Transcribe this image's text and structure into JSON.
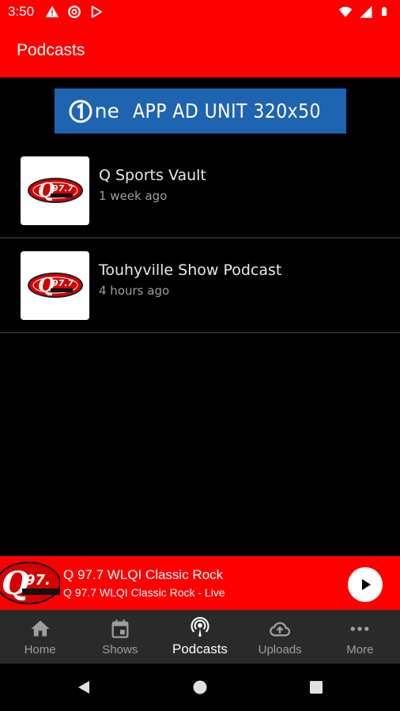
{
  "status_bar": {
    "time": "3:50",
    "left_icons": [
      "warning-icon",
      "at-sign-icon",
      "play-store-icon"
    ],
    "right_icons": [
      "wifi-icon",
      "signal-icon",
      "battery-icon"
    ]
  },
  "app_bar": {
    "title": "Podcasts"
  },
  "ad": {
    "logo_text": "ne",
    "text": "APP AD UNIT 320x50"
  },
  "podcasts": [
    {
      "title": "Q Sports Vault",
      "time": "1 week ago"
    },
    {
      "title": "Touhyville Show Podcast",
      "time": "4 hours ago"
    }
  ],
  "now_playing": {
    "station": "Q 97.7 WLQI Classic Rock",
    "subtitle": "Q 97.7 WLQI Classic Rock - Live"
  },
  "bottom_nav": [
    {
      "label": "Home",
      "icon": "home-icon"
    },
    {
      "label": "Shows",
      "icon": "calendar-icon"
    },
    {
      "label": "Podcasts",
      "icon": "podcast-icon",
      "active": true
    },
    {
      "label": "Uploads",
      "icon": "cloud-upload-icon"
    },
    {
      "label": "More",
      "icon": "more-icon"
    }
  ],
  "colors": {
    "accent": "#ff0000",
    "nav_bg": "#2a2a2a",
    "ad_blue": "#1f64b1"
  }
}
